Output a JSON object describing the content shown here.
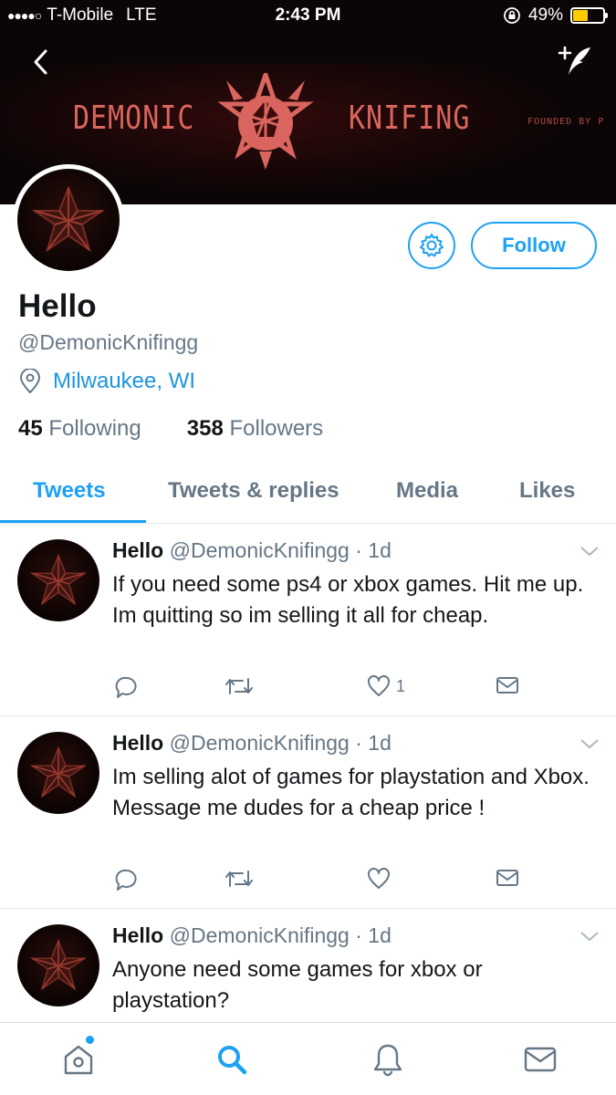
{
  "status_bar": {
    "signal": "●●●●○",
    "carrier": "T-Mobile",
    "network": "LTE",
    "time": "2:43 PM",
    "battery_text": "49%"
  },
  "banner": {
    "word_left": "DEMONIC",
    "word_right": "KNIFING",
    "small_text": "FOUNDED BY P"
  },
  "profile": {
    "name": "Hello",
    "handle": "@DemonicKnifingg",
    "location": "Milwaukee, WI",
    "following_count": "45",
    "following_label": "Following",
    "followers_count": "358",
    "followers_label": "Followers",
    "follow_label": "Follow"
  },
  "tabs": [
    {
      "label": "Tweets",
      "active": true
    },
    {
      "label": "Tweets & replies",
      "active": false
    },
    {
      "label": "Media",
      "active": false
    },
    {
      "label": "Likes",
      "active": false
    }
  ],
  "tweets": [
    {
      "name": "Hello",
      "handle": "@DemonicKnifingg",
      "time": "· 1d",
      "text": "If you need some ps4 or xbox games. Hit me up. Im quitting so im selling it all for cheap.",
      "like_count": "1"
    },
    {
      "name": "Hello",
      "handle": "@DemonicKnifingg",
      "time": "· 1d",
      "text": "Im selling alot of games for playstation and Xbox. Message me dudes for a cheap price !",
      "like_count": ""
    },
    {
      "name": "Hello",
      "handle": "@DemonicKnifingg",
      "time": "· 1d",
      "text": "Anyone need some games for xbox or playstation?",
      "like_count": ""
    }
  ],
  "colors": {
    "accent": "#1da1f2",
    "secondary_text": "#657786",
    "battery": "#ffcc00",
    "banner_red": "#d9655e"
  },
  "icons": {
    "back": "chevron-left-icon",
    "compose": "compose-tweet-icon",
    "gear": "gear-icon",
    "location": "location-pin-icon",
    "reply": "reply-icon",
    "retweet": "retweet-icon",
    "like": "heart-icon",
    "dm": "direct-message-icon",
    "home": "home-icon",
    "search": "search-icon",
    "notifications": "bell-icon",
    "messages": "mail-icon"
  }
}
